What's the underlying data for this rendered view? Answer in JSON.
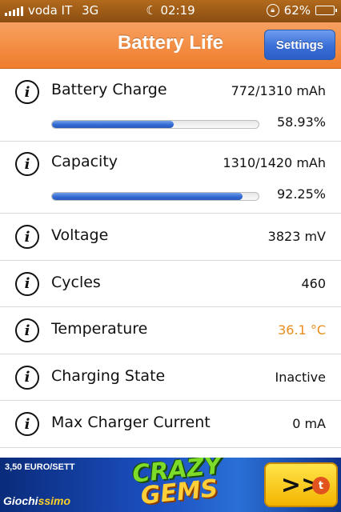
{
  "status_bar": {
    "carrier": "voda IT",
    "network": "3G",
    "time": "02:19",
    "battery_percent": "62%",
    "battery_level": 0.62,
    "icons": [
      "signal-icon",
      "moon-icon",
      "rotation-lock-icon",
      "battery-icon"
    ]
  },
  "nav": {
    "title": "Battery Life",
    "settings_label": "Settings"
  },
  "rows": [
    {
      "label": "Battery Charge",
      "value": "772/1310 mAh",
      "percent": "58.93%",
      "progress": 0.5893
    },
    {
      "label": "Capacity",
      "value": "1310/1420 mAh",
      "percent": "92.25%",
      "progress": 0.9225
    },
    {
      "label": "Voltage",
      "value": "3823 mV"
    },
    {
      "label": "Cycles",
      "value": "460"
    },
    {
      "label": "Temperature",
      "value": "36.1 °C"
    },
    {
      "label": "Charging State",
      "value": "Inactive"
    },
    {
      "label": "Max Charger Current",
      "value": "0 mA"
    }
  ],
  "info_glyph": "i",
  "ad": {
    "price": "3,50 EURO/SETT",
    "brand_prefix": "Giochi",
    "brand_suffix": "ssimo",
    "game_word1": "CRAZY",
    "game_word2": "GEMS",
    "play_glyph": ">>",
    "badge": "t"
  },
  "colors": {
    "nav_orange": "#ef7d2c",
    "settings_blue": "#3a6fd6",
    "progress_blue": "#2f67d1",
    "temperature_orange": "#e88c1a"
  }
}
